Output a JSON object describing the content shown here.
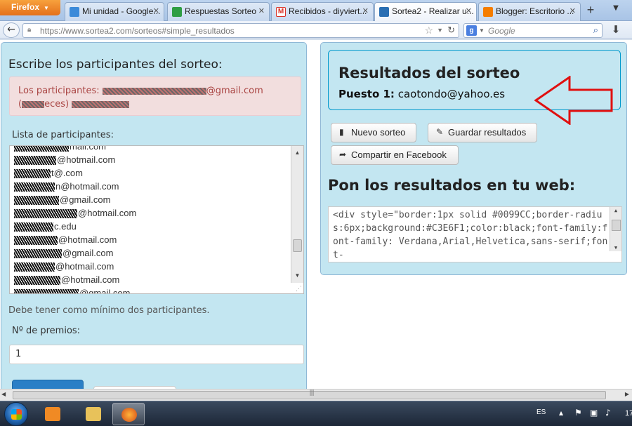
{
  "browser": {
    "app_button": "Firefox",
    "tabs": [
      {
        "title": "Mi unidad - Google...",
        "favicon_color": "#3b8ad9"
      },
      {
        "title": "Respuestas Sorteo",
        "favicon_color": "#2f9e44"
      },
      {
        "title": "Recibidos - diyviert...",
        "favicon_color": "#d93025"
      },
      {
        "title": "Sortea2 - Realizar u...",
        "favicon_color": "#2a6fb3"
      },
      {
        "title": "Blogger: Escritorio ...",
        "favicon_color": "#f57d00"
      }
    ],
    "active_tab": 3,
    "url": "https://www.sortea2.com/sorteos#simple_resultados",
    "search_placeholder": "Google"
  },
  "left": {
    "title": "Escribe los participantes del sorteo:",
    "alert_line1_prefix": "Los participantes:",
    "alert_line1_suffix": "@gmail.com",
    "alert_line2_prefix": "(",
    "alert_line2_mid": "eces)",
    "list_label": "Lista de participantes:",
    "participants": [
      {
        "suffix": "mail.com"
      },
      {
        "suffix": "@hotmail.com"
      },
      {
        "suffix": "t@.com"
      },
      {
        "suffix": "n@hotmail.com"
      },
      {
        "suffix": "@gmail.com"
      },
      {
        "suffix": "@hotmail.com"
      },
      {
        "suffix": "c.edu"
      },
      {
        "suffix": "@hotmail.com"
      },
      {
        "suffix": "@gmail.com"
      },
      {
        "suffix": "@hotmail.com"
      },
      {
        "suffix": "@hotmail.com"
      },
      {
        "suffix": "@gmail.com"
      }
    ],
    "min_hint": "Debe tener como mínimo dos participantes.",
    "prizes_label": "Nº de premios:",
    "prizes_value": "1"
  },
  "right": {
    "results_title": "Resultados del sorteo",
    "place_label": "Puesto 1:",
    "winner": "caotondo@yahoo.es",
    "btn_new": "Nuevo sorteo",
    "btn_save": "Guardar resultados",
    "btn_share": "Compartir en Facebook",
    "web_title": "Pon los resultados en tu web:",
    "embed_code": "<div style=\"border:1px solid #0099CC;border-radius:6px;background:#C3E6F1;color:black;font-family:font-family: Verdana,Arial,Helvetica,sans-serif;font-"
  },
  "taskbar": {
    "language": "ES",
    "clock": "17"
  },
  "colors": {
    "panel_bg": "#c3e6f1",
    "alert_bg": "#f2dede",
    "alert_text": "#a94442",
    "arrow": "#e01010",
    "primary_button": "#2a7fc6"
  }
}
